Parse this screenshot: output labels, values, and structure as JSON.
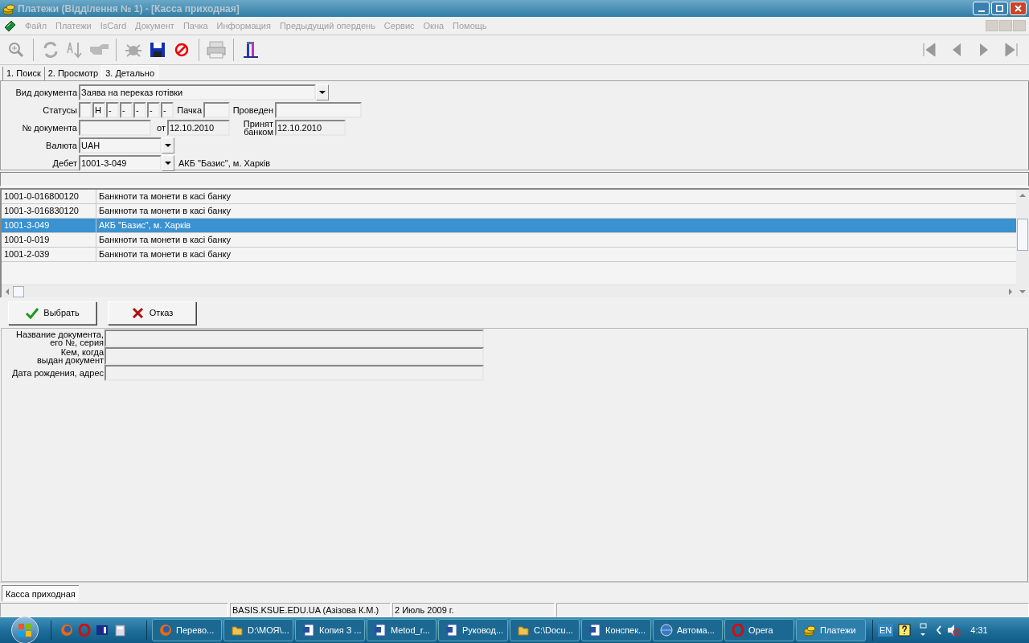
{
  "window": {
    "title": "Платежи (Відділення № 1) - [Касса приходная]"
  },
  "menu": [
    {
      "label": "Файл",
      "disabled": true
    },
    {
      "label": "Платежи",
      "disabled": true
    },
    {
      "label": "IsCard",
      "disabled": true
    },
    {
      "label": "Документ",
      "disabled": true
    },
    {
      "label": "Пачка",
      "disabled": true
    },
    {
      "label": "Информация",
      "disabled": true
    },
    {
      "label": "Предыдущий опердень",
      "disabled": true
    },
    {
      "label": "Сервис",
      "disabled": true
    },
    {
      "label": "Окна",
      "disabled": true
    },
    {
      "label": "Помощь",
      "disabled": true
    }
  ],
  "tabs": [
    {
      "label": "1. Поиск",
      "selected": false
    },
    {
      "label": "2. Просмотр",
      "selected": false
    },
    {
      "label": "3. Детально",
      "selected": true
    }
  ],
  "form": {
    "doc_type": {
      "label": "Вид документа",
      "value": "Заява на переказ готівки"
    },
    "statuses": {
      "label": "Статусы",
      "boxes": [
        {
          "kind": "blank"
        },
        {
          "kind": "text",
          "value": "Н"
        },
        {
          "kind": "text",
          "value": "-"
        },
        {
          "kind": "text",
          "value": "-"
        },
        {
          "kind": "text",
          "value": "-"
        },
        {
          "kind": "text",
          "value": "-"
        },
        {
          "kind": "text",
          "value": "-"
        }
      ]
    },
    "batch": {
      "label": "Пачка"
    },
    "posted": {
      "label": "Проведен"
    },
    "doc_number": {
      "label": "№ документа"
    },
    "date_from": {
      "label": "от",
      "value": "12.10.2010"
    },
    "accepted": {
      "label": "Принят банком",
      "value": "12.10.2010"
    },
    "currency": {
      "label": "Валюта",
      "value": "UAH"
    },
    "debit": {
      "label": "Дебет",
      "value": "1001-3-049",
      "description": "АКБ \"Базис\", м. Харків"
    }
  },
  "table": {
    "rows": [
      {
        "account": "1001-0-016800120",
        "name": "Банкноти та монети в касі банку",
        "selected": false
      },
      {
        "account": "1001-3-016830120",
        "name": "Банкноти та монети в касі банку",
        "selected": false
      },
      {
        "account": "1001-3-049",
        "name": "АКБ \"Базис\", м. Харків",
        "selected": true
      },
      {
        "account": "1001-0-019",
        "name": "Банкноти та монети в касі банку",
        "selected": false
      },
      {
        "account": "1001-2-039",
        "name": "Банкноти та монети в касі банку",
        "selected": false
      }
    ]
  },
  "buttons": [
    {
      "label": "Выбрать",
      "kind": "ok"
    },
    {
      "label": "Отказ",
      "kind": "cancel"
    }
  ],
  "details": [
    {
      "label": "Название документа,\nего №, серия"
    },
    {
      "label": "Кем, когда\nвыдан документ"
    },
    {
      "label": "Дата рождения, адрес"
    }
  ],
  "document_tab": "Касса приходная",
  "status_bar": [
    "BASIS.KSUE.EDU.UA (Азізова К.М.)",
    "2 Июль 2009 г."
  ],
  "taskbar": {
    "tasks": [
      {
        "label": "Перево...",
        "kind": "browser",
        "selected": false
      },
      {
        "label": "D:\\МОЯ\\...",
        "kind": "folder",
        "selected": false
      },
      {
        "label": "Копия З ...",
        "kind": "document",
        "selected": false
      },
      {
        "label": "Metod_r...",
        "kind": "document",
        "selected": false
      },
      {
        "label": "Руковод...",
        "kind": "document",
        "selected": false
      },
      {
        "label": "C:\\Docu...",
        "kind": "folder",
        "selected": false
      },
      {
        "label": "Конспек...",
        "kind": "document",
        "selected": false
      },
      {
        "label": "Автома...",
        "kind": "web",
        "selected": false
      },
      {
        "label": "Opera",
        "kind": "opera",
        "selected": false
      },
      {
        "label": "Платежи",
        "kind": "payments",
        "selected": true
      }
    ],
    "language": "EN",
    "clock": "4:31"
  }
}
